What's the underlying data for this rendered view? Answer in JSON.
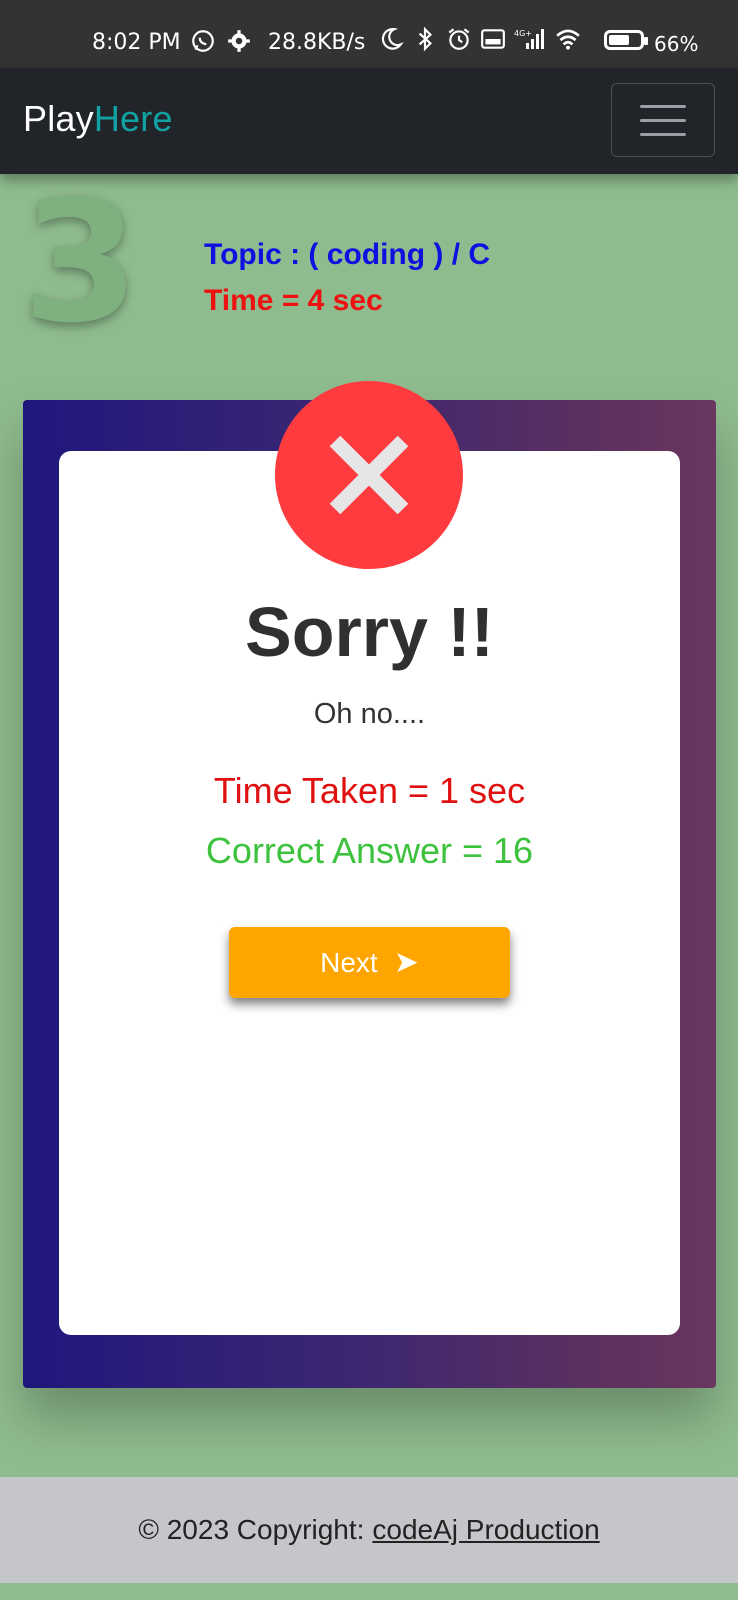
{
  "status_bar": {
    "time": "8:02 PM",
    "speed": "28.8KB/s",
    "network": "4G+",
    "battery_percent": "66%",
    "battery_level": 0.66,
    "icons": [
      "whatsapp-icon",
      "settings-icon",
      "moon-icon",
      "bluetooth-icon",
      "alarm-icon",
      "volte-icon",
      "signal-icon",
      "wifi-icon",
      "battery-icon"
    ]
  },
  "navbar": {
    "brand_part1": "Play",
    "brand_part2": "Here",
    "brand_accent_color": "#11a3a3",
    "menu_icon": "hamburger-icon"
  },
  "question": {
    "number": "3",
    "topic": "Topic : ( coding ) / C",
    "time_limit": "Time = 4 sec"
  },
  "result": {
    "icon": "close-icon",
    "title": "Sorry !!",
    "subtitle": "Oh no....",
    "time_taken": "Time Taken = 1 sec",
    "correct_answer": "Correct Answer = 16",
    "next_label": "Next",
    "next_icon": "arrow-right-icon",
    "colors": {
      "error": "#fe3b3f",
      "time_taken": "#e01010",
      "correct": "#3cc23c",
      "button": "#ffa500"
    }
  },
  "footer": {
    "copyright": "© 2023 Copyright:",
    "link_text": "codeAj Production"
  }
}
